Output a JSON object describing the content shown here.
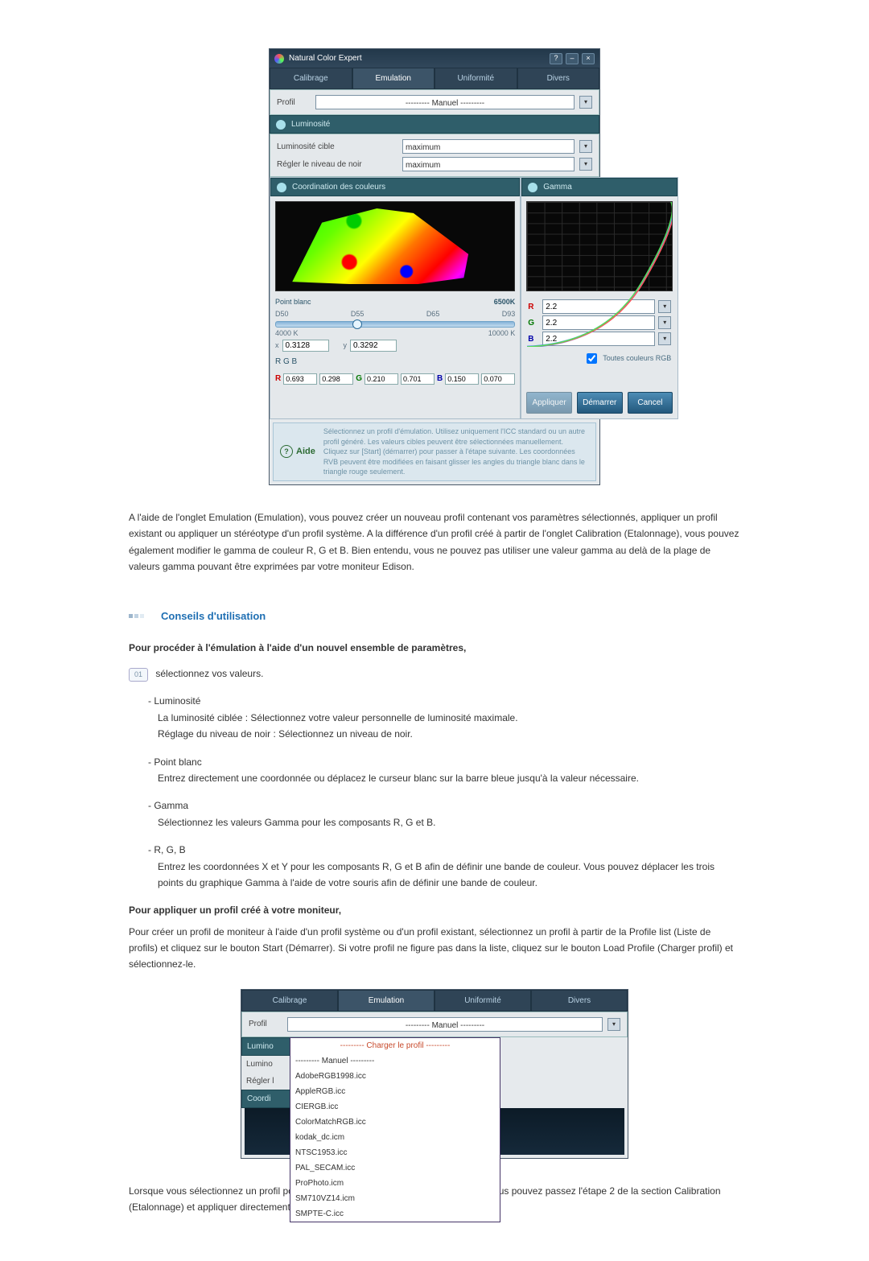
{
  "app": {
    "title": "Natural Color Expert",
    "tabs": [
      "Calibrage",
      "Emulation",
      "Uniformité",
      "Divers"
    ],
    "active_tab": 1,
    "profil_label": "Profil",
    "profil_value": "--------- Manuel ---------",
    "luminosite_hdr": "Luminosité",
    "lum_target_label": "Luminosité cible",
    "lum_target_value": "maximum",
    "black_level_label": "Régler le niveau de noir",
    "black_level_value": "maximum",
    "coord_hdr": "Coordination des couleurs",
    "gamma_hdr": "Gamma",
    "white_point_label": "Point blanc",
    "white_point_temp": "6500K",
    "wp_ticks": [
      "D50",
      "D55",
      "D65",
      "D93"
    ],
    "wp_range_low": "4000 K",
    "wp_range_high": "10000 K",
    "x_label": "x",
    "x_value": "0.3128",
    "y_label": "y",
    "y_value": "0.3292",
    "rgb_header": "R G B",
    "rgb_r": [
      "0.693",
      "0.298"
    ],
    "rgb_g": [
      "0.210",
      "0.701"
    ],
    "rgb_b": [
      "0.150",
      "0.070"
    ],
    "gamma_r": "2.2",
    "gamma_g": "2.2",
    "gamma_b": "2.2",
    "allcolors_label": "Toutes couleurs RGB",
    "btn_apply": "Appliquer",
    "btn_start": "Démarrer",
    "btn_cancel": "Cancel",
    "aide_label": "Aide",
    "aide_text": "Sélectionnez un profil d'émulation. Utilisez uniquement l'ICC standard ou un autre profil généré. Les valeurs cibles peuvent être sélectionnées manuellement. Cliquez sur [Start] (démarrer) pour passer à l'étape suivante. Les coordonnées RVB peuvent être modifiées en faisant glisser les angles du triangle blanc dans le triangle rouge seulement."
  },
  "shot2": {
    "tabs": [
      "Calibrage",
      "Emulation",
      "Uniformité",
      "Divers"
    ],
    "profil_label": "Profil",
    "profil_value": "--------- Manuel ---------",
    "lumin_hdr": "Lumino",
    "lum_row1": "Lumino",
    "lum_row2": "Régler l",
    "coord_hdr": "Coordi",
    "options": [
      "--------- Charger le profil ---------",
      "--------- Manuel ---------",
      "AdobeRGB1998.icc",
      "AppleRGB.icc",
      "CIERGB.icc",
      "ColorMatchRGB.icc",
      "kodak_dc.icm",
      "NTSC1953.icc",
      "PAL_SECAM.icc",
      "ProPhoto.icm",
      "SM710VZ14.icm",
      "SMPTE-C.icc"
    ]
  },
  "doc": {
    "p1": "A l'aide de l'onglet Emulation (Emulation), vous pouvez créer un nouveau profil contenant vos paramètres sélectionnés, appliquer un profil existant ou appliquer un stéréotype d'un profil système. A la différence d'un profil créé à partir de l'onglet Calibration (Etalonnage), vous pouvez également modifier le gamma de couleur R, G et B. Bien entendu, vous ne pouvez pas utiliser une valeur gamma au delà de la plage de valeurs gamma pouvant être exprimées par votre moniteur Edison.",
    "section_title": "Conseils d'utilisation",
    "sub1": "Pour procéder à l'émulation à l'aide d'un nouvel ensemble de paramètres,",
    "step01": "sélectionnez vos valeurs.",
    "items": [
      {
        "name": "Luminosité",
        "lines": [
          "La luminosité ciblée : Sélectionnez votre valeur personnelle de luminosité maximale.",
          "Réglage du niveau de noir : Sélectionnez un niveau de noir."
        ]
      },
      {
        "name": "Point blanc",
        "lines": [
          "Entrez directement une coordonnée ou déplacez le curseur blanc sur la barre bleue jusqu'à la valeur nécessaire."
        ]
      },
      {
        "name": "Gamma",
        "lines": [
          "Sélectionnez les valeurs Gamma pour les composants R, G et B."
        ]
      },
      {
        "name": "R, G, B",
        "lines": [
          "Entrez les coordonnées X et Y pour les composants R, G et B afin de définir une bande de couleur. Vous pouvez déplacer les trois points du graphique Gamma à l'aide de votre souris afin de définir une bande de couleur."
        ]
      }
    ],
    "sub2": "Pour appliquer un profil créé à votre moniteur,",
    "p2": "Pour créer un profil de moniteur à l'aide d'un profil système ou d'un profil existant, sélectionnez un profil à partir de la Profile list (Liste de profils) et cliquez sur le bouton Start (Démarrer). Si votre profil ne figure pas dans la liste, cliquez sur le bouton Load Profile (Charger profil) et sélectionnez-le.",
    "p3": "Lorsque vous sélectionnez un profil pour lequel vous avez déjà effectué l'émulation, vous pouvez passez l'étape 2 de la section Calibration (Etalonnage) et appliquer directement les paramètres en"
  },
  "chart_data": {
    "type": "line",
    "title": "Gamma",
    "series": [
      {
        "name": "R",
        "values": "y = x^2.2 (normalized 0–1)"
      },
      {
        "name": "G",
        "values": "y = x^2.2 (normalized 0–1)"
      },
      {
        "name": "B",
        "values": "y = x^2.2 (normalized 0–1)"
      }
    ],
    "xlim": [
      0,
      1
    ],
    "ylim": [
      0,
      1
    ]
  }
}
